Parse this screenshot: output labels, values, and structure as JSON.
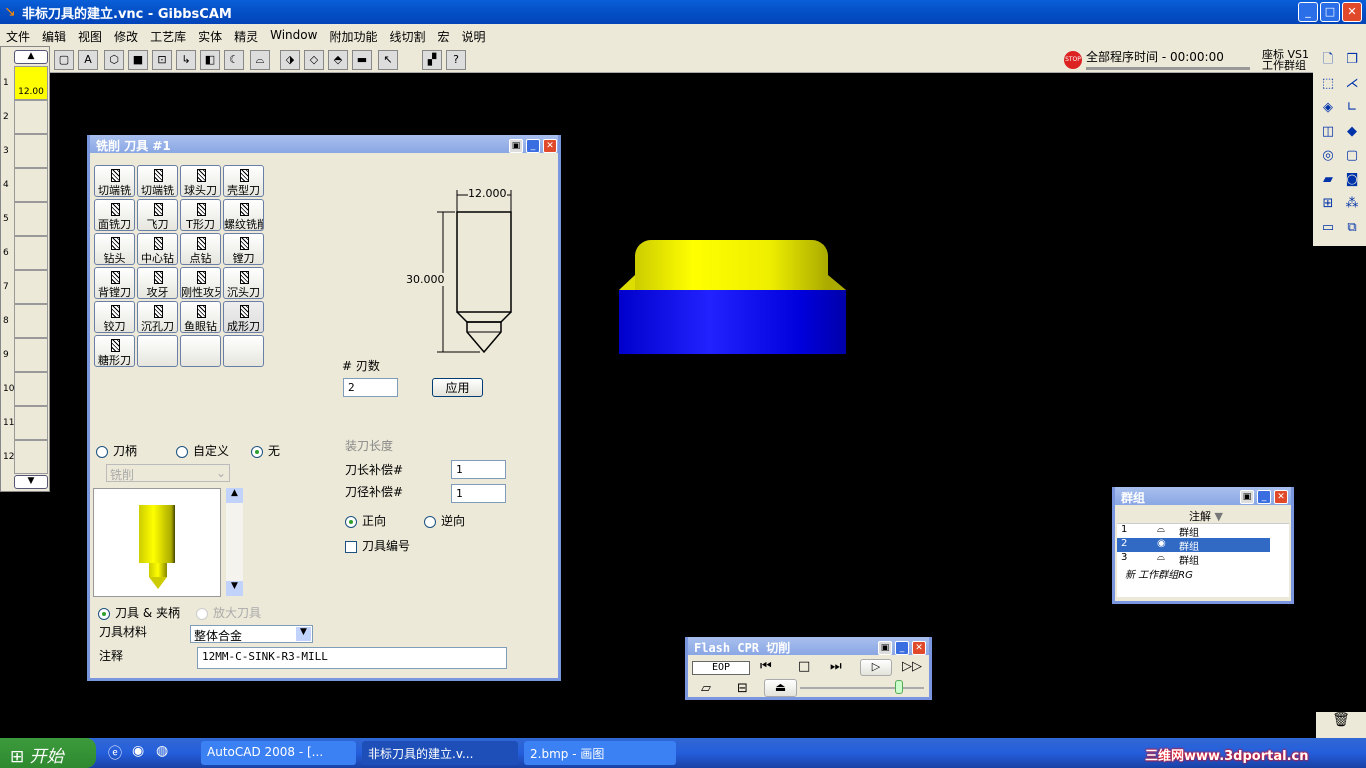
{
  "window": {
    "title": "非标刀具的建立.vnc - GibbsCAM",
    "min": "_",
    "max": "□",
    "close": "✕"
  },
  "menu": [
    "文件",
    "编辑",
    "视图",
    "修改",
    "工艺库",
    "实体",
    "精灵",
    "Window",
    "附加功能",
    "线切割",
    "宏",
    "说明"
  ],
  "toolbar_icons": [
    "view-box",
    "view-a",
    "solid-cube",
    "shaded-cube",
    "select-box",
    "axis",
    "color",
    "circle",
    "surface",
    "select-solid",
    "wire",
    "rod",
    "shape-toolbar",
    "pointer",
    "render-modes",
    "help"
  ],
  "status": {
    "stop_icon": "STOP",
    "program_time": "全部程序时间 - 00:00:00",
    "coord": "座标 VS1",
    "workgroup": "工作群组"
  },
  "left_panel": {
    "slots": [
      "1",
      "2",
      "3",
      "4",
      "5",
      "6",
      "7",
      "8",
      "9",
      "10",
      "11",
      "12"
    ],
    "active_value": "12.00"
  },
  "tool_dialog": {
    "title": "铣削 刀具 #1",
    "tools": [
      "切端铣",
      "切端铣",
      "球头刀",
      "壳型刀",
      "面铣刀",
      "飞刀",
      "T形刀",
      "螺纹铣削",
      "钻头",
      "中心钻",
      "点钻",
      "镗刀",
      "背镗刀",
      "攻牙",
      "刚性攻牙",
      "沉头刀",
      "铰刀",
      "沉孔刀",
      "鱼眼钻",
      "成形刀",
      "糖形刀",
      "",
      "",
      ""
    ],
    "dim_width": "12.000",
    "dim_length": "30.000",
    "flutes_label": "# 刃数",
    "flutes_value": "2",
    "apply": "应用",
    "holder_options": [
      "刀柄",
      "自定义",
      "无"
    ],
    "holder_selected": "无",
    "holder_type": "铣削",
    "mount_length_label": "装刀长度",
    "length_comp_label": "刀长补偿#",
    "length_comp_value": "1",
    "dia_comp_label": "刀径补偿#",
    "dia_comp_value": "1",
    "direction": [
      "正向",
      "逆向"
    ],
    "direction_selected": "正向",
    "tool_number_label": "刀具编号",
    "tool_number_checked": false,
    "view_options": [
      "刀具 & 夹柄",
      "放大刀具"
    ],
    "material_label": "刀具材料",
    "material_value": "整体合金",
    "comment_label": "注释",
    "comment_value": "12MM-C-SINK-R3-MILL"
  },
  "group_window": {
    "title": "群组",
    "column": "注解",
    "rows": [
      {
        "n": "1",
        "name": "群组",
        "selected": false
      },
      {
        "n": "2",
        "name": "群组",
        "selected": true
      },
      {
        "n": "3",
        "name": "群组",
        "selected": false
      }
    ],
    "new": "新 工作群组RG"
  },
  "flash_window": {
    "title": "Flash CPR 切削",
    "eop": "EOP",
    "slider_fraction": 0.8
  },
  "taskbar": {
    "start": "开始",
    "tasks": [
      "AutoCAD 2008 - [...",
      "非标刀具的建立.v...",
      "2.bmp - 画图"
    ],
    "watermark": "三维网www.3dportal.cn"
  },
  "colors": {
    "part_top": "#e6e600",
    "part_bottom": "#0000e0",
    "selection": "#316ac5"
  }
}
